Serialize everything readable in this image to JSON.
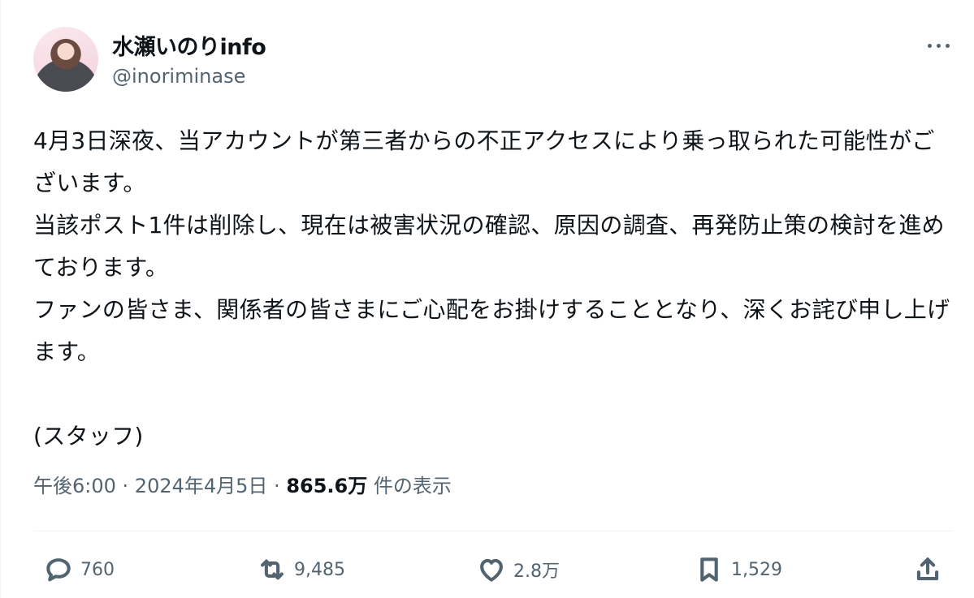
{
  "author": {
    "display_name": "水瀬いのりinfo",
    "handle": "@inoriminase"
  },
  "tweet": {
    "text": "4月3日深夜、当アカウントが第三者からの不正アクセスにより乗っ取られた可能性がございます。\n当該ポスト1件は削除し、現在は被害状況の確認、原因の調査、再発防止策の検討を進めております。\nファンの皆さま、関係者の皆さまにご心配をお掛けすることとなり、深くお詫び申し上げます。\n\n(スタッフ)",
    "time": "午後6:00",
    "separator": " · ",
    "date": "2024年4月5日",
    "views": "865.6万",
    "views_label": " 件の表示"
  },
  "actions": {
    "reply": {
      "icon": "reply-icon",
      "count": "760"
    },
    "repost": {
      "icon": "repost-icon",
      "count": "9,485"
    },
    "like": {
      "icon": "heart-icon",
      "count": "2.8万"
    },
    "bookmark": {
      "icon": "bookmark-icon",
      "count": "1,529"
    },
    "share": {
      "icon": "share-icon"
    }
  },
  "colors": {
    "text": "#0f1419",
    "secondary": "#536471",
    "divider": "#eff3f4"
  }
}
